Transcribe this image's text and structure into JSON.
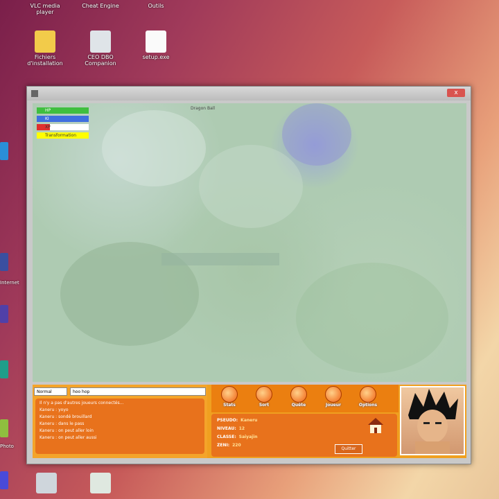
{
  "desktop": {
    "top_labels": [
      "VLC media player",
      "Cheat Engine",
      "Outils"
    ],
    "icons": [
      {
        "label": "Fichiers d'installation",
        "icon": "folder-icon"
      },
      {
        "label": "CEO DBO Companion",
        "icon": "program-icon"
      },
      {
        "label": "setup.exe",
        "icon": "document-icon"
      }
    ],
    "left_labels": [
      "Internet",
      "Photo"
    ],
    "bottom_icons": [
      {
        "icon": "settings-icon"
      },
      {
        "icon": "app-icon"
      }
    ]
  },
  "window": {
    "close_label": "x"
  },
  "game": {
    "map_tooltip": "Dragon Ball",
    "stats": [
      {
        "label": "HP",
        "color": "#3fbf3f",
        "fill": 1.0
      },
      {
        "label": "KI",
        "color": "#3f6fdf",
        "fill": 1.0
      },
      {
        "label": "XP",
        "color": "#df2f2f",
        "fill": 0.25
      },
      {
        "label": "Transformation",
        "color": "#ffff00",
        "fill": 1.0
      }
    ],
    "chat": {
      "mode": "Normal",
      "input_value": "hoo hop",
      "lines": [
        "Il n'y a pas d'autres joueurs connectés...",
        "Kaneru : yoyo",
        "Kaneru : sondé brouillard",
        "Kaneru : dans le pass",
        "Kaneru : on peut aller loin",
        "Kaneru : on peut aller aussi"
      ]
    },
    "menu_buttons": [
      {
        "label": "Stats"
      },
      {
        "label": "Sort"
      },
      {
        "label": "Quête"
      },
      {
        "label": "Joueur"
      },
      {
        "label": "Options"
      }
    ],
    "info": {
      "pseudo_label": "PSEUDO:",
      "pseudo_value": "Kaneru",
      "level_label": "NIVEAU:",
      "level_value": "12",
      "class_label": "CLASSE:",
      "class_value": "Saiyajin",
      "zeni_label": "ZENI:",
      "zeni_value": "220",
      "option_label": "Quitter"
    }
  }
}
